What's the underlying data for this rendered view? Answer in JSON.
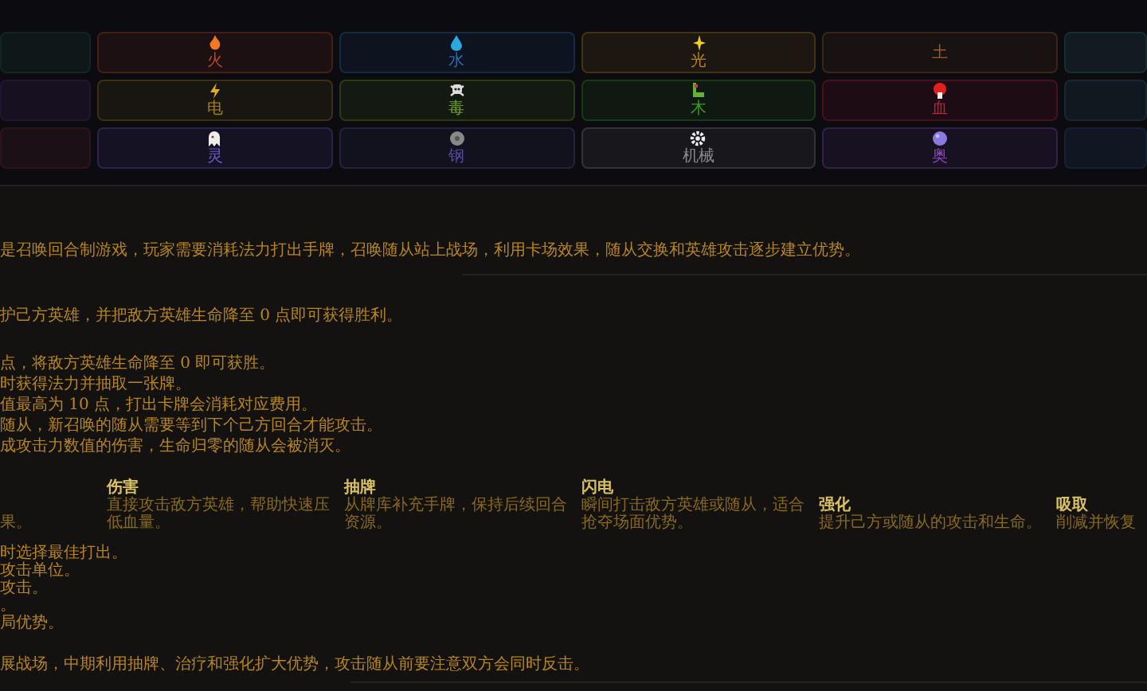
{
  "element_grid": [
    {
      "kind": "partial",
      "color": "#16302a"
    },
    {
      "kind": "full",
      "label": "火",
      "color": "#c0462b"
    },
    {
      "kind": "full",
      "label": "水",
      "color": "#2a6db0"
    },
    {
      "kind": "full",
      "label": "光",
      "color": "#b8861a"
    },
    {
      "kind": "full",
      "label": "土",
      "color": "#9a5a2a"
    },
    {
      "kind": "partial",
      "color": "#1c3a40"
    },
    {
      "kind": "partial",
      "color": "#2a1a40"
    },
    {
      "kind": "full",
      "label": "电",
      "color": "#a08020"
    },
    {
      "kind": "full",
      "label": "毒",
      "color": "#6aa020"
    },
    {
      "kind": "full",
      "label": "木",
      "color": "#3a9a1a"
    },
    {
      "kind": "full",
      "label": "血",
      "color": "#c02030"
    },
    {
      "kind": "partial",
      "color": "#1c3440"
    },
    {
      "kind": "partial",
      "color": "#3a1a20"
    },
    {
      "kind": "full",
      "label": "灵",
      "color": "#6a5acd"
    },
    {
      "kind": "full",
      "label": "钢",
      "color": "#5a4aa0"
    },
    {
      "kind": "full",
      "label": "机械",
      "color": "#8a8a8a"
    },
    {
      "kind": "full",
      "label": "奥",
      "color": "#8a4ac0"
    },
    {
      "kind": "partial",
      "color": "#1a2a44"
    }
  ],
  "intro": "是召唤回合制游戏，玩家需要消耗法力打出手牌，召唤随从站上战场，利用卡场效果，随从交换和英雄攻击逐步建立优势。",
  "goal": "护己方英雄，并把敌方英雄生命降至 0 点即可获得胜利。",
  "rules": [
    "点，将敌方英雄生命降至 0 即可获胜。",
    "时获得法力并抽取一张牌。",
    "值最高为 10 点，打出卡牌会消耗对应费用。",
    "随从，新召唤的随从需要等到下个己方回合才能攻击。",
    "成攻击力数值的伤害，生命归零的随从会被消灭。"
  ],
  "keywords": [
    {
      "description": "果。"
    },
    {
      "name": "伤害",
      "description": "直接攻击敌方英雄，帮助快速压低血量。"
    },
    {
      "name": "抽牌",
      "description": "从牌库补充手牌，保持后续回合资源。"
    },
    {
      "name": "闪电",
      "description": "瞬间打击敌方英雄或随从，适合抢夺场面优势。"
    },
    {
      "name": "强化",
      "description": "提升己方或随从的攻击和生命。"
    },
    {
      "name": "吸取",
      "description": "削减并恢复"
    }
  ],
  "tips": [
    "时选择最佳打出。",
    "攻击单位。",
    "攻击。",
    "。",
    "局优势。"
  ],
  "strategy": "展战场，中期利用抽牌、治疗和强化扩大优势，攻击随从前要注意双方会同时反击。"
}
